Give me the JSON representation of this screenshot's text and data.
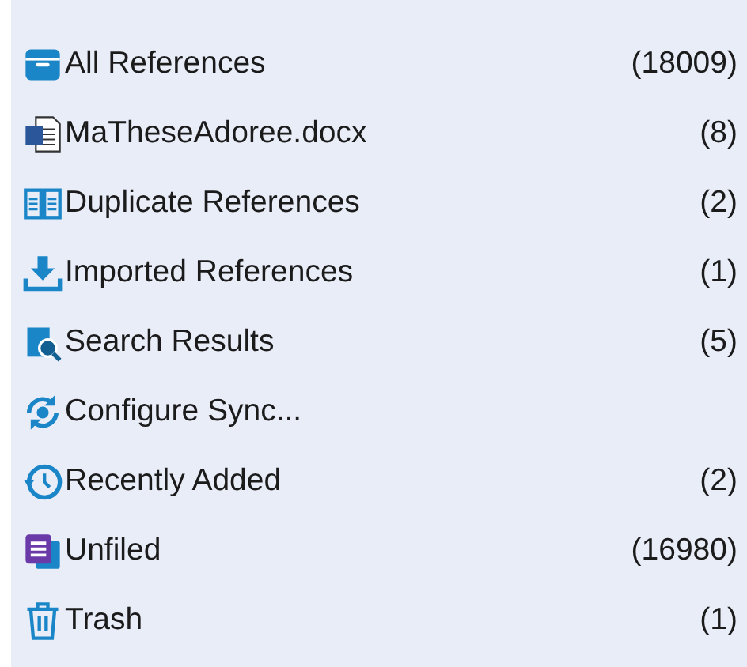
{
  "groups": [
    {
      "kind": "all",
      "label": "All References",
      "count": "(18009)"
    },
    {
      "kind": "document",
      "label": "MaTheseAdoree.docx",
      "count": "(8)"
    },
    {
      "kind": "duplicates",
      "label": "Duplicate References",
      "count": "(2)"
    },
    {
      "kind": "imported",
      "label": "Imported References",
      "count": "(1)"
    },
    {
      "kind": "search",
      "label": "Search Results",
      "count": "(5)"
    },
    {
      "kind": "sync",
      "label": "Configure Sync..."
    },
    {
      "kind": "recent",
      "label": "Recently Added",
      "count": "(2)"
    },
    {
      "kind": "unfiled",
      "label": "Unfiled",
      "count": "(16980)"
    },
    {
      "kind": "trash",
      "label": "Trash",
      "count": "(1)"
    }
  ]
}
